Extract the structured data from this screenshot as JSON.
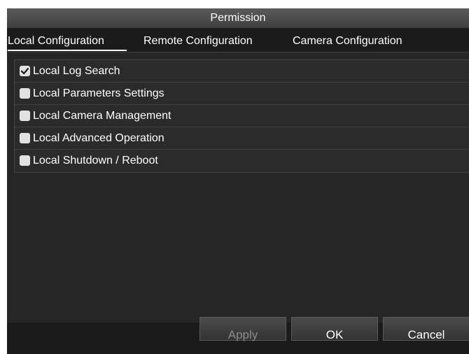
{
  "window": {
    "title": "Permission"
  },
  "tabs": [
    {
      "label": "Local Configuration",
      "active": true
    },
    {
      "label": "Remote Configuration",
      "active": false
    },
    {
      "label": "Camera Configuration",
      "active": false
    }
  ],
  "permissions": [
    {
      "label": "Local Log Search",
      "checked": true
    },
    {
      "label": "Local Parameters Settings",
      "checked": false
    },
    {
      "label": "Local Camera Management",
      "checked": false
    },
    {
      "label": "Local Advanced Operation",
      "checked": false
    },
    {
      "label": "Local Shutdown / Reboot",
      "checked": false
    }
  ],
  "buttons": {
    "apply_label": "Apply",
    "ok_label": "OK",
    "cancel_label": "Cancel"
  },
  "colors": {
    "background": "#1b1b1b",
    "panel": "#262626",
    "text": "#ffffff",
    "disabled_text": "#8c8c8c",
    "checkbox": "#e1e1e1"
  }
}
